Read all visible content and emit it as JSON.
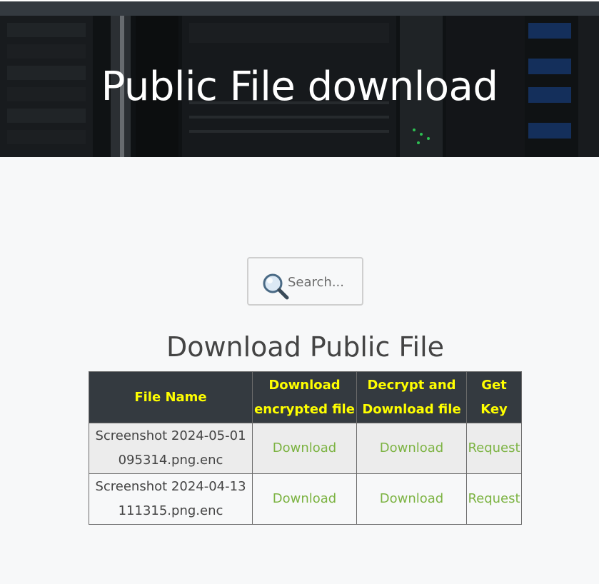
{
  "hero": {
    "title": "Public File download"
  },
  "search": {
    "placeholder": "Search..."
  },
  "section": {
    "title": "Download Public File"
  },
  "table": {
    "headers": {
      "file_name": "File Name",
      "download_encrypted": [
        "Download",
        "encrypted file"
      ],
      "decrypt_download": [
        "Decrypt and",
        "Download file"
      ],
      "get_key": "Get Key"
    },
    "rows": [
      {
        "file_name": [
          "Screenshot 2024-05-01",
          "095314.png.enc"
        ],
        "download_encrypted": "Download",
        "decrypt_download": "Download",
        "get_key": "Request"
      },
      {
        "file_name": [
          "Screenshot 2024-04-13",
          "111315.png.enc"
        ],
        "download_encrypted": "Download",
        "decrypt_download": "Download",
        "get_key": "Request"
      }
    ]
  },
  "colors": {
    "header_bg": "#343a40",
    "header_text": "#ffff00",
    "link": "#7cb342"
  },
  "icons": {
    "search": "magnifying-glass-icon"
  }
}
